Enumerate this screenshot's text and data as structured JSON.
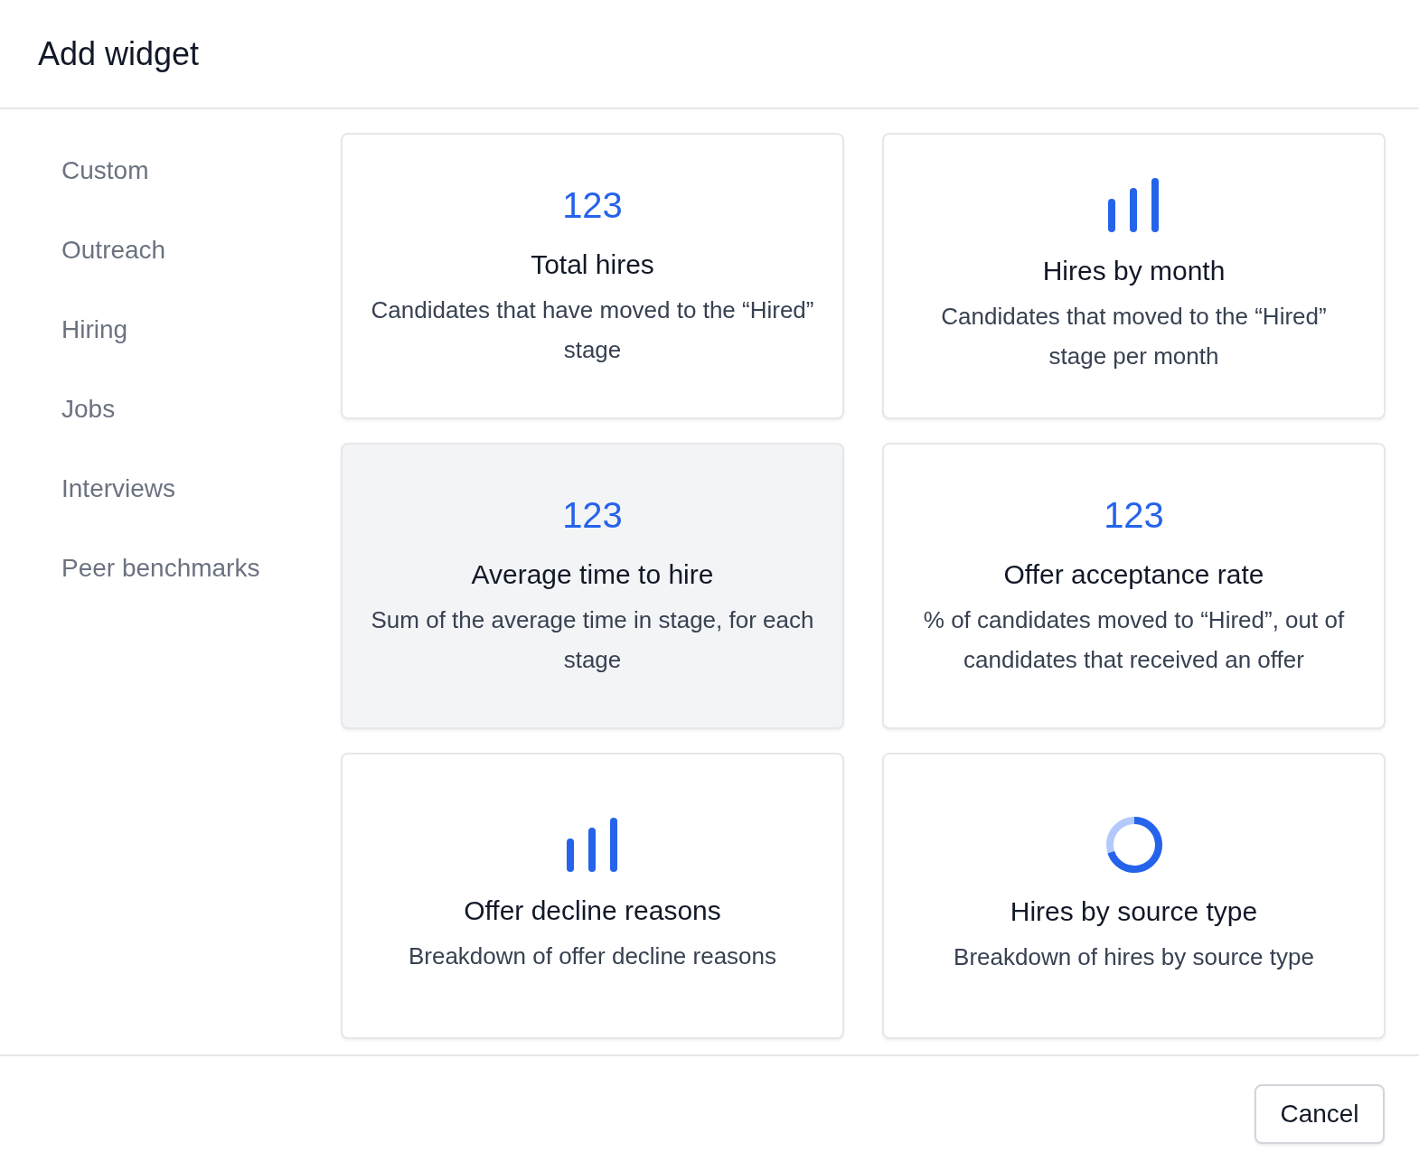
{
  "dialog": {
    "title": "Add widget"
  },
  "sidebar": {
    "items": [
      {
        "label": "Custom"
      },
      {
        "label": "Outreach"
      },
      {
        "label": "Hiring"
      },
      {
        "label": "Jobs"
      },
      {
        "label": "Interviews"
      },
      {
        "label": "Peer benchmarks"
      }
    ]
  },
  "widgets": [
    {
      "kind": "number",
      "number": "123",
      "title": "Total hires",
      "description": "Candidates that have moved to the “Hired” stage",
      "selected": false
    },
    {
      "kind": "bar",
      "title": "Hires by month",
      "description": "Candidates that moved to the “Hired” stage per month",
      "selected": false
    },
    {
      "kind": "number",
      "number": "123",
      "title": "Average time to hire",
      "description": "Sum of the average time in stage, for each stage",
      "selected": true
    },
    {
      "kind": "number",
      "number": "123",
      "title": "Offer acceptance rate",
      "description": "% of candidates moved to “Hired”, out of candidates that received an offer",
      "selected": false
    },
    {
      "kind": "bar",
      "title": "Offer decline reasons",
      "description": "Breakdown of offer decline reasons",
      "selected": false
    },
    {
      "kind": "donut",
      "title": "Hires by source type",
      "description": "Breakdown of hires by source type",
      "selected": false
    }
  ],
  "footer": {
    "buttons": [
      "Cancel"
    ]
  }
}
